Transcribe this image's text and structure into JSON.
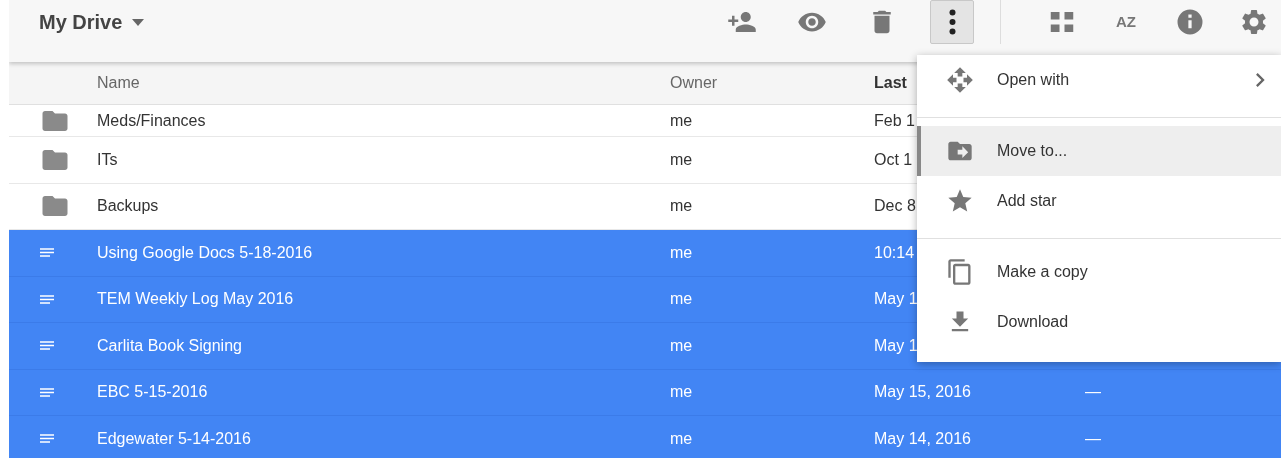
{
  "header": {
    "title": "My Drive",
    "toolbar": [
      {
        "kind": "add-person",
        "pressed": false
      },
      {
        "kind": "eye",
        "pressed": false
      },
      {
        "kind": "trash",
        "pressed": false
      },
      {
        "kind": "more",
        "pressed": true
      },
      {
        "kind": "grid",
        "pressed": false
      },
      {
        "kind": "sort",
        "label": "AZ",
        "pressed": false
      },
      {
        "kind": "info",
        "pressed": false
      },
      {
        "kind": "settings",
        "pressed": false
      }
    ]
  },
  "table": {
    "columns": [
      {
        "label": "Name",
        "sorted": false
      },
      {
        "label": "Owner",
        "sorted": false
      },
      {
        "label": "Last",
        "sorted": true
      }
    ],
    "rows": [
      {
        "kind": "folder",
        "name": "Meds/Finances",
        "owner": "me",
        "modified": "Feb 1",
        "selected": false
      },
      {
        "kind": "folder",
        "name": "ITs",
        "owner": "me",
        "modified": "Oct 1",
        "selected": false
      },
      {
        "kind": "folder",
        "name": "Backups",
        "owner": "me",
        "modified": "Dec 8",
        "selected": false
      },
      {
        "kind": "doc",
        "name": "Using Google Docs 5-18-2016",
        "owner": "me",
        "modified": "10:14",
        "selected": true
      },
      {
        "kind": "doc",
        "name": "TEM Weekly Log May 2016",
        "owner": "me",
        "modified": "May 1",
        "selected": true
      },
      {
        "kind": "doc",
        "name": "Carlita Book Signing",
        "owner": "me",
        "modified": "May 1",
        "selected": true
      },
      {
        "kind": "doc",
        "name": "EBC 5-15-2016",
        "owner": "me",
        "modified": "May 15, 2016",
        "column_4": "—",
        "selected": true
      },
      {
        "kind": "doc",
        "name": "Edgewater 5-14-2016",
        "owner": "me",
        "modified": "May 14, 2016",
        "column_4": "—",
        "selected": true
      }
    ]
  },
  "context_menu": {
    "groups": [
      [
        {
          "kind": "arrows",
          "label": "Open with",
          "submenu": true,
          "selected": false
        }
      ],
      [
        {
          "kind": "folder-move",
          "label": "Move to...",
          "submenu": false,
          "selected": true
        },
        {
          "kind": "star",
          "label": "Add star",
          "submenu": false,
          "selected": false
        }
      ],
      [
        {
          "kind": "copy",
          "label": "Make a copy",
          "submenu": false,
          "selected": false
        },
        {
          "kind": "download",
          "label": "Download",
          "submenu": false,
          "selected": false
        }
      ]
    ]
  }
}
